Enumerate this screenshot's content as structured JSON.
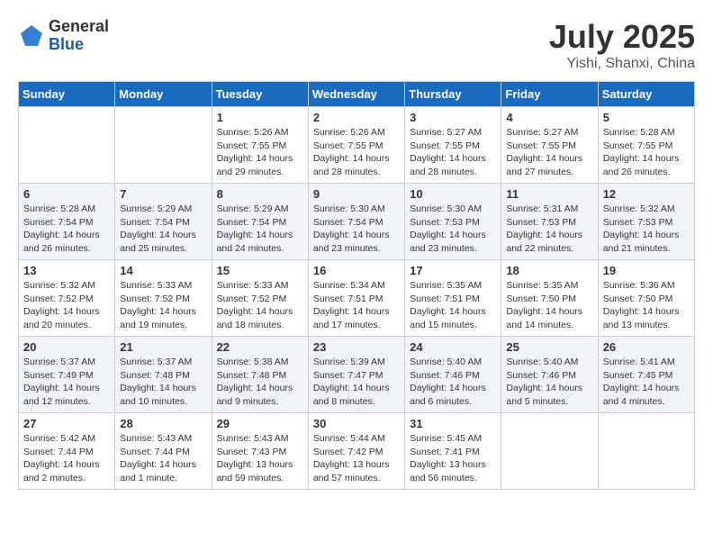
{
  "logo": {
    "general": "General",
    "blue": "Blue"
  },
  "title": "July 2025",
  "location": "Yishi, Shanxi, China",
  "days_of_week": [
    "Sunday",
    "Monday",
    "Tuesday",
    "Wednesday",
    "Thursday",
    "Friday",
    "Saturday"
  ],
  "weeks": [
    [
      {
        "day": "",
        "info": ""
      },
      {
        "day": "",
        "info": ""
      },
      {
        "day": "1",
        "info": "Sunrise: 5:26 AM\nSunset: 7:55 PM\nDaylight: 14 hours\nand 29 minutes."
      },
      {
        "day": "2",
        "info": "Sunrise: 5:26 AM\nSunset: 7:55 PM\nDaylight: 14 hours\nand 28 minutes."
      },
      {
        "day": "3",
        "info": "Sunrise: 5:27 AM\nSunset: 7:55 PM\nDaylight: 14 hours\nand 28 minutes."
      },
      {
        "day": "4",
        "info": "Sunrise: 5:27 AM\nSunset: 7:55 PM\nDaylight: 14 hours\nand 27 minutes."
      },
      {
        "day": "5",
        "info": "Sunrise: 5:28 AM\nSunset: 7:55 PM\nDaylight: 14 hours\nand 26 minutes."
      }
    ],
    [
      {
        "day": "6",
        "info": "Sunrise: 5:28 AM\nSunset: 7:54 PM\nDaylight: 14 hours\nand 26 minutes."
      },
      {
        "day": "7",
        "info": "Sunrise: 5:29 AM\nSunset: 7:54 PM\nDaylight: 14 hours\nand 25 minutes."
      },
      {
        "day": "8",
        "info": "Sunrise: 5:29 AM\nSunset: 7:54 PM\nDaylight: 14 hours\nand 24 minutes."
      },
      {
        "day": "9",
        "info": "Sunrise: 5:30 AM\nSunset: 7:54 PM\nDaylight: 14 hours\nand 23 minutes."
      },
      {
        "day": "10",
        "info": "Sunrise: 5:30 AM\nSunset: 7:53 PM\nDaylight: 14 hours\nand 23 minutes."
      },
      {
        "day": "11",
        "info": "Sunrise: 5:31 AM\nSunset: 7:53 PM\nDaylight: 14 hours\nand 22 minutes."
      },
      {
        "day": "12",
        "info": "Sunrise: 5:32 AM\nSunset: 7:53 PM\nDaylight: 14 hours\nand 21 minutes."
      }
    ],
    [
      {
        "day": "13",
        "info": "Sunrise: 5:32 AM\nSunset: 7:52 PM\nDaylight: 14 hours\nand 20 minutes."
      },
      {
        "day": "14",
        "info": "Sunrise: 5:33 AM\nSunset: 7:52 PM\nDaylight: 14 hours\nand 19 minutes."
      },
      {
        "day": "15",
        "info": "Sunrise: 5:33 AM\nSunset: 7:52 PM\nDaylight: 14 hours\nand 18 minutes."
      },
      {
        "day": "16",
        "info": "Sunrise: 5:34 AM\nSunset: 7:51 PM\nDaylight: 14 hours\nand 17 minutes."
      },
      {
        "day": "17",
        "info": "Sunrise: 5:35 AM\nSunset: 7:51 PM\nDaylight: 14 hours\nand 15 minutes."
      },
      {
        "day": "18",
        "info": "Sunrise: 5:35 AM\nSunset: 7:50 PM\nDaylight: 14 hours\nand 14 minutes."
      },
      {
        "day": "19",
        "info": "Sunrise: 5:36 AM\nSunset: 7:50 PM\nDaylight: 14 hours\nand 13 minutes."
      }
    ],
    [
      {
        "day": "20",
        "info": "Sunrise: 5:37 AM\nSunset: 7:49 PM\nDaylight: 14 hours\nand 12 minutes."
      },
      {
        "day": "21",
        "info": "Sunrise: 5:37 AM\nSunset: 7:48 PM\nDaylight: 14 hours\nand 10 minutes."
      },
      {
        "day": "22",
        "info": "Sunrise: 5:38 AM\nSunset: 7:48 PM\nDaylight: 14 hours\nand 9 minutes."
      },
      {
        "day": "23",
        "info": "Sunrise: 5:39 AM\nSunset: 7:47 PM\nDaylight: 14 hours\nand 8 minutes."
      },
      {
        "day": "24",
        "info": "Sunrise: 5:40 AM\nSunset: 7:46 PM\nDaylight: 14 hours\nand 6 minutes."
      },
      {
        "day": "25",
        "info": "Sunrise: 5:40 AM\nSunset: 7:46 PM\nDaylight: 14 hours\nand 5 minutes."
      },
      {
        "day": "26",
        "info": "Sunrise: 5:41 AM\nSunset: 7:45 PM\nDaylight: 14 hours\nand 4 minutes."
      }
    ],
    [
      {
        "day": "27",
        "info": "Sunrise: 5:42 AM\nSunset: 7:44 PM\nDaylight: 14 hours\nand 2 minutes."
      },
      {
        "day": "28",
        "info": "Sunrise: 5:43 AM\nSunset: 7:44 PM\nDaylight: 14 hours\nand 1 minute."
      },
      {
        "day": "29",
        "info": "Sunrise: 5:43 AM\nSunset: 7:43 PM\nDaylight: 13 hours\nand 59 minutes."
      },
      {
        "day": "30",
        "info": "Sunrise: 5:44 AM\nSunset: 7:42 PM\nDaylight: 13 hours\nand 57 minutes."
      },
      {
        "day": "31",
        "info": "Sunrise: 5:45 AM\nSunset: 7:41 PM\nDaylight: 13 hours\nand 56 minutes."
      },
      {
        "day": "",
        "info": ""
      },
      {
        "day": "",
        "info": ""
      }
    ]
  ]
}
